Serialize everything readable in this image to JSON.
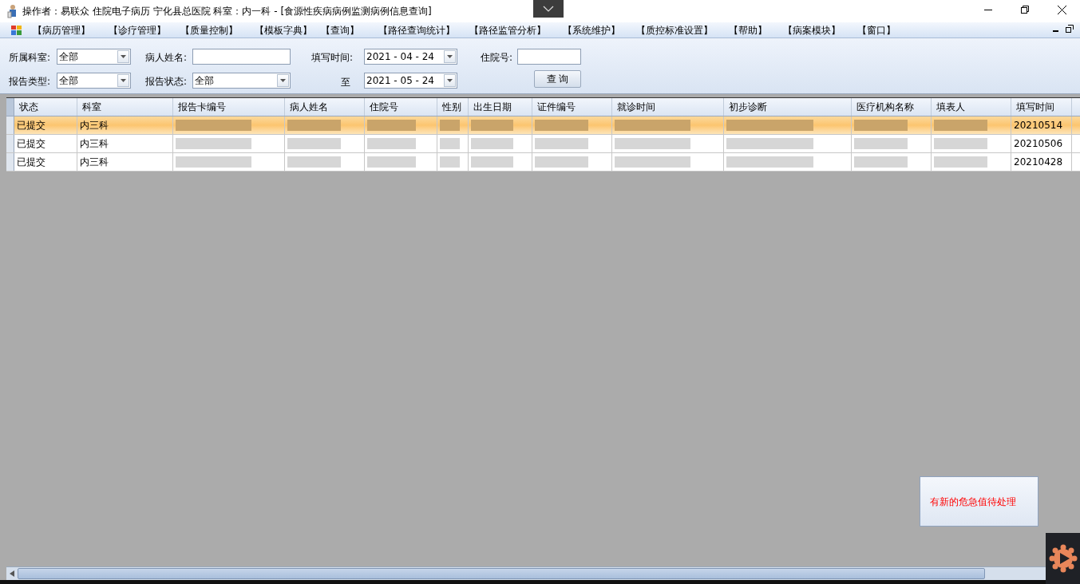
{
  "window": {
    "title": "操作者：易联众 住院电子病历  宁化县总医院  科室：内一科 - [食源性疾病病例监测病例信息查询]"
  },
  "menu": [
    "【病历管理】",
    "【诊疗管理】",
    "【质量控制】",
    "【模板字典】",
    "【查询】",
    "【路径查询统计】",
    "【路径监管分析】",
    "【系统维护】",
    "【质控标准设置】",
    "【帮助】",
    "【病案模块】",
    "【窗口】"
  ],
  "filters": {
    "department": {
      "label": "所属科室:",
      "value": "全部"
    },
    "patient_name": {
      "label": "病人姓名:"
    },
    "fill_time": {
      "label": "填写时间:",
      "value": "2021 - 04 - 24"
    },
    "admission_no": {
      "label": "住院号:"
    },
    "report_type": {
      "label": "报告类型:",
      "value": "全部"
    },
    "report_status": {
      "label": "报告状态:",
      "value": "全部"
    },
    "to": {
      "label": "至",
      "value": "2021 - 05 - 24"
    },
    "query_button": "查 询"
  },
  "table": {
    "columns": [
      "状态",
      "科室",
      "报告卡编号",
      "病人姓名",
      "住院号",
      "性别",
      "出生日期",
      "证件编号",
      "就诊时间",
      "初步诊断",
      "医疗机构名称",
      "填表人",
      "填写时间"
    ],
    "rows": [
      {
        "status": "已提交",
        "department": "内三科",
        "fill_time": "20210514",
        "selected": true
      },
      {
        "status": "已提交",
        "department": "内三科",
        "fill_time": "20210506",
        "selected": false
      },
      {
        "status": "已提交",
        "department": "内三科",
        "fill_time": "20210428",
        "selected": false
      }
    ]
  },
  "notification": "有新的危急值待处理"
}
